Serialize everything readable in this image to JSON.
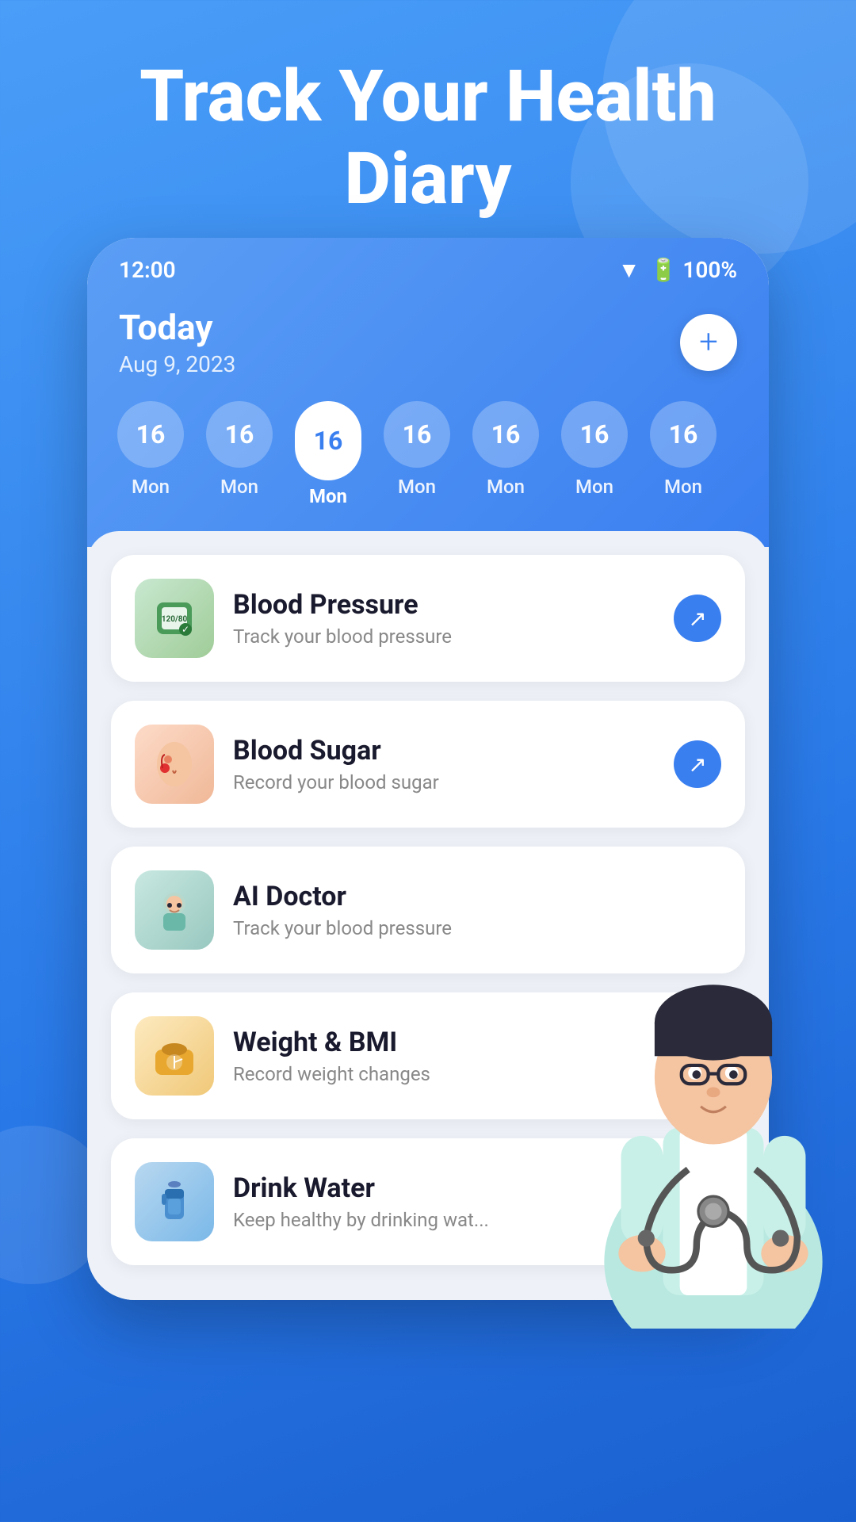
{
  "background": {
    "color": "#3a80f0"
  },
  "hero": {
    "title": "Track Your Health\nDiary"
  },
  "status_bar": {
    "time": "12:00",
    "battery": "100%"
  },
  "today": {
    "label": "Today",
    "date": "Aug 9, 2023"
  },
  "add_button": {
    "label": "+"
  },
  "days": [
    {
      "number": "16",
      "day": "Mon",
      "active": false
    },
    {
      "number": "16",
      "day": "Mon",
      "active": false
    },
    {
      "number": "16",
      "day": "Mon",
      "active": true
    },
    {
      "number": "16",
      "day": "Mon",
      "active": false
    },
    {
      "number": "16",
      "day": "Mon",
      "active": false
    },
    {
      "number": "16",
      "day": "Mon",
      "active": false
    },
    {
      "number": "16",
      "day": "Mon",
      "active": false
    }
  ],
  "cards": [
    {
      "id": "blood-pressure",
      "title": "Blood Pressure",
      "subtitle": "Track your blood pressure",
      "icon_type": "bp",
      "has_arrow": true
    },
    {
      "id": "blood-sugar",
      "title": "Blood Sugar",
      "subtitle": "Record your blood sugar",
      "icon_type": "sugar",
      "has_arrow": true
    },
    {
      "id": "ai-doctor",
      "title": "AI Doctor",
      "subtitle": "Track your blood pressure",
      "icon_type": "ai",
      "has_arrow": false
    },
    {
      "id": "weight-bmi",
      "title": "Weight & BMI",
      "subtitle": "Record weight changes",
      "icon_type": "weight",
      "has_arrow": false
    },
    {
      "id": "drink-water",
      "title": "Drink Water",
      "subtitle": "Keep healthy by drinking wat...",
      "icon_type": "water",
      "has_arrow": false
    }
  ]
}
